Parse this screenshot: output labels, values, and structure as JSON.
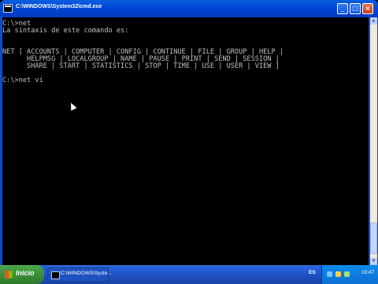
{
  "window": {
    "title": "C:\\WINDOWS\\System32\\cmd.exe",
    "buttons": {
      "minimize": "_",
      "maximize": "□",
      "close": "×"
    }
  },
  "console": {
    "lines": [
      "C:\\>net",
      "La sintaxis de este comando es:",
      "",
      "",
      "NET [ ACCOUNTS | COMPUTER | CONFIG | CONTINUE | FILE | GROUP | HELP |",
      "      HELPMSG | LOCALGROUP | NAME | PAUSE | PRINT | SEND | SESSION |",
      "      SHARE | START | STATISTICS | STOP | TIME | USE | USER | VIEW ]",
      "",
      "C:\\>net vi"
    ]
  },
  "taskbar": {
    "start_label": "Inicio",
    "task_label": "C:\\WINDOWS\\Syste...",
    "language": "ES",
    "clock": "10:47"
  },
  "icons": {
    "app": "cmd-icon",
    "start": "windows-flag-icon",
    "cursor": "mouse-pointer-icon"
  }
}
